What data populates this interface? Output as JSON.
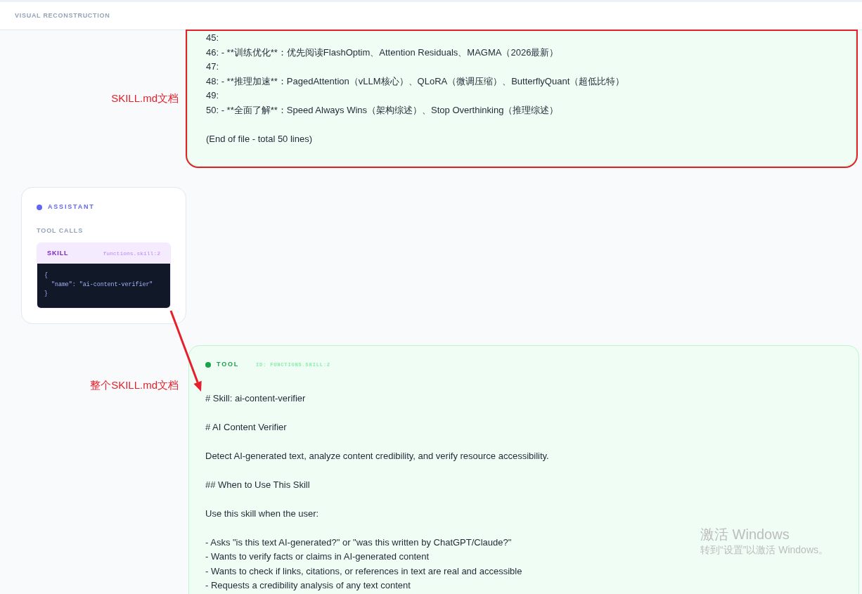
{
  "header": {
    "title": "VISUAL RECONSTRUCTION"
  },
  "messages": [
    {
      "kind": "tool_output",
      "highlighted": true,
      "annotation_label": "SKILL.md文档",
      "paragraphs": [
        [
          "45:",
          "46: - **训练优化**：优先阅读FlashOptim、Attention Residuals、MAGMA（2026最新）",
          "47:",
          "48: - **推理加速**：PagedAttention（vLLM核心）、QLoRA（微调压缩）、ButterflyQuant（超低比特）",
          "49:",
          "50: - **全面了解**：Speed Always Wins（架构综述）、Stop Overthinking（推理综述）"
        ],
        [
          "(End of file - total 50 lines)"
        ]
      ]
    },
    {
      "kind": "assistant",
      "role": "ASSISTANT",
      "section": "TOOL CALLS",
      "tool_calls": [
        {
          "name": "SKILL",
          "id": "functions.skill:2",
          "code": [
            "{",
            "  \"name\": \"ai-content-verifier\"",
            "}"
          ]
        }
      ]
    },
    {
      "kind": "tool",
      "arrow_in": true,
      "annotation_label": "整个SKILL.md文档",
      "role": "TOOL",
      "id": "ID: FUNCTIONS.SKILL:2",
      "paragraphs": [
        [
          "# Skill: ai-content-verifier"
        ],
        [
          "# AI Content Verifier"
        ],
        [
          "Detect AI-generated text, analyze content credibility, and verify resource accessibility."
        ],
        [
          "## When to Use This Skill"
        ],
        [
          "Use this skill when the user:"
        ],
        [
          "- Asks \"is this text AI-generated?\" or \"was this written by ChatGPT/Claude?\"",
          "- Wants to verify facts or claims in AI-generated content",
          "- Wants to check if links, citations, or references in text are real and accessible",
          "- Requests a credibility analysis of any text content"
        ]
      ]
    }
  ],
  "os_notice": {
    "title": "激活 Windows",
    "subtitle": "转到“设置”以激活 Windows。"
  }
}
